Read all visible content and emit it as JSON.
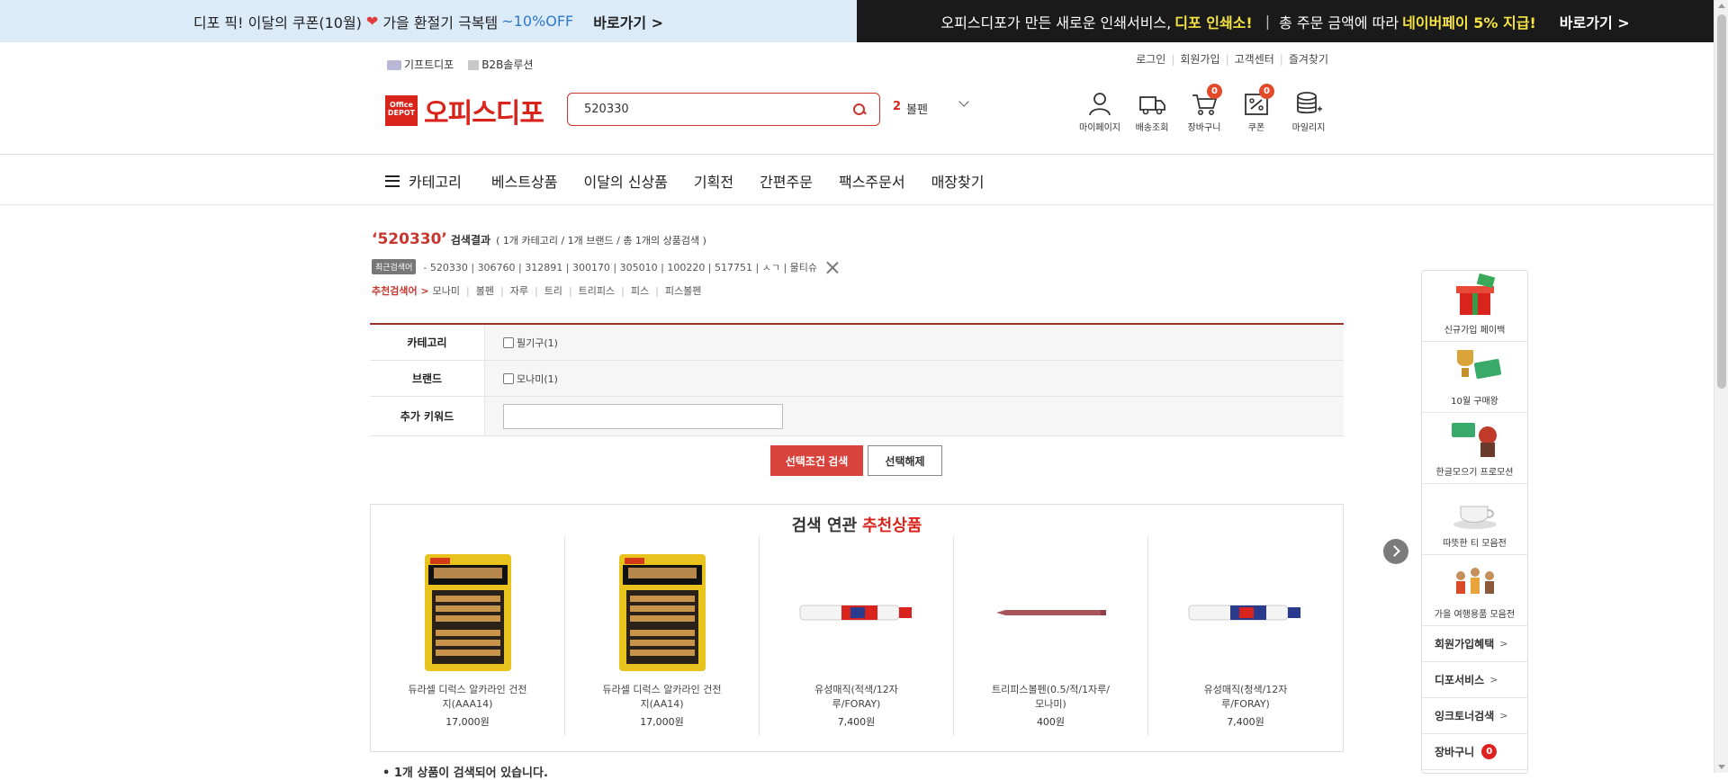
{
  "promo": {
    "left": {
      "text1": "디포 픽! 이달의 쿠폰(10월)",
      "text2": "가을 환절기 극복템",
      "discount": "~10%OFF",
      "cta": "바로가기 >"
    },
    "right": {
      "text1": "오피스디포가 만든 새로운 인쇄서비스,",
      "highlight1": "디포 인쇄소!",
      "text2": "총 주문 금액에 따라",
      "highlight2": "네이버페이 5% 지급!",
      "cta": "바로가기 >"
    }
  },
  "header": {
    "util_left": [
      "기프트디포",
      "B2B솔루션"
    ],
    "util_right": [
      "로그인",
      "회원가입",
      "고객센터",
      "즐겨찾기"
    ],
    "logo": {
      "mark": "Office DEPOT",
      "name": "오피스디포"
    },
    "search": {
      "value": "520330"
    },
    "rank": {
      "number": "2",
      "keyword": "볼펜"
    },
    "shortcuts": [
      {
        "label": "마이페이지",
        "icon": "person-icon"
      },
      {
        "label": "배송조회",
        "icon": "truck-icon"
      },
      {
        "label": "장바구니",
        "icon": "cart-icon",
        "count": "0"
      },
      {
        "label": "쿠폰",
        "icon": "coupon-icon",
        "count": "0"
      },
      {
        "label": "마일리지",
        "icon": "mileage-icon"
      }
    ]
  },
  "nav": {
    "category": "카테고리",
    "items": [
      "베스트상품",
      "이달의 신상품",
      "기획전",
      "간편주문",
      "팩스주문서",
      "매장찾기"
    ]
  },
  "result": {
    "keyword": "‘520330’",
    "label": "검색결과",
    "meta": "( 1개 카테고리 / 1개 브랜드 / 총 1개의 상품검색 )",
    "recent_tag": "최근검색어",
    "recent": "- 520330 | 306760 | 312891 | 300170 | 305010 | 100220 | 517751 | ㅅㄱ | 물티슈",
    "recommend_lead": "추천검색어 >",
    "recommend": [
      "모나미",
      "볼펜",
      "자루",
      "트리",
      "트리피스",
      "피스",
      "피스볼펜"
    ]
  },
  "filter": {
    "rows": [
      {
        "label": "카테고리",
        "option": "필기구(1)"
      },
      {
        "label": "브랜드",
        "option": "모나미(1)"
      },
      {
        "label": "추가 키워드"
      }
    ],
    "search_btn": "선택조건 검색",
    "reset_btn": "선택해제"
  },
  "related": {
    "title": "검색 연관",
    "title_highlight": "추천상품",
    "products": [
      {
        "name": "듀라셀 디럭스 알카라인 건전지(AAA14)",
        "price": "17,000원"
      },
      {
        "name": "듀라셀 디럭스 알카라인 건전지(AA14)",
        "price": "17,000원"
      },
      {
        "name": "유성매직(적색/12자루/FORAY)",
        "price": "7,400원"
      },
      {
        "name": "트리피스볼펜(0.5/적/1자루/모나미)",
        "price": "400원"
      },
      {
        "name": "유성매직(청색/12자루/FORAY)",
        "price": "7,400원"
      }
    ]
  },
  "bottom_note": "• 1개 상품이 검색되어 있습니다.",
  "quick": {
    "items": [
      "신규가입 페이백",
      "10월 구매왕",
      "한글모으기 프로모션",
      "따뜻한 티 모음전",
      "가을 여행용품 모음전"
    ],
    "links": [
      "회원가입혜택",
      "디포서비스",
      "잉크토너검색"
    ],
    "cart_label": "장바구니",
    "cart_count": "0",
    "chevron": ">"
  }
}
